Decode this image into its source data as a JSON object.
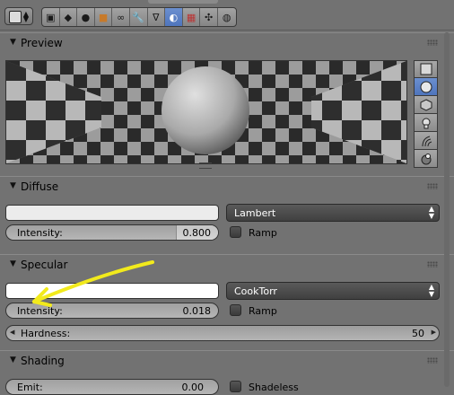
{
  "toolbar": {
    "editor_type_icon": "properties-editor-icon",
    "tabs": [
      {
        "icon": "render-icon"
      },
      {
        "icon": "scene-icon"
      },
      {
        "icon": "world-icon"
      },
      {
        "icon": "object-icon"
      },
      {
        "icon": "constraints-icon"
      },
      {
        "icon": "modifiers-icon"
      },
      {
        "icon": "data-icon"
      },
      {
        "icon": "material-icon"
      },
      {
        "icon": "texture-icon"
      },
      {
        "icon": "particles-icon"
      },
      {
        "icon": "physics-icon"
      }
    ],
    "active_tab": "material-icon"
  },
  "preview": {
    "title": "Preview",
    "shape_buttons": [
      "flat-icon",
      "sphere-icon",
      "cube-icon",
      "monkey-icon",
      "hair-icon",
      "sphere-sky-icon"
    ],
    "active_shape": "sphere-icon"
  },
  "diffuse": {
    "title": "Diffuse",
    "color": "#ececec",
    "shader": "Lambert",
    "intensity_label": "Intensity:",
    "intensity_value": "0.800",
    "ramp_label": "Ramp"
  },
  "specular": {
    "title": "Specular",
    "color": "#ffffff",
    "shader": "CookTorr",
    "intensity_label": "Intensity:",
    "intensity_value": "0.018",
    "ramp_label": "Ramp",
    "hardness_label": "Hardness:",
    "hardness_value": "50"
  },
  "shading": {
    "title": "Shading",
    "emit_label": "Emit:",
    "emit_value": "0.00",
    "shadeless_label": "Shadeless"
  },
  "colors": {
    "panel_bg": "#727272",
    "active_blue": "#5a80c6",
    "annotation_arrow": "#f2ea1c"
  }
}
